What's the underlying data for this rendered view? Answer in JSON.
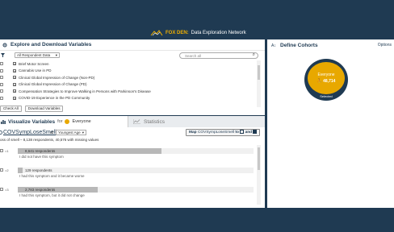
{
  "header": {
    "brand": "FOX DEN:",
    "subtitle": "Data Exploration Network"
  },
  "explore": {
    "title": "Explore and Download Variables",
    "dataset_select": "All Respondent Data",
    "search_placeholder": "Search all",
    "variables": [
      "Brief Motor Screen",
      "Cannabis Use in PD",
      "Clinical Global Impression of Change (Non-PD)",
      "Clinical Global Impression of Change (PD)",
      "Compensation Strategies to Improve Walking in Persons with Parkinson's Disease",
      "COVID-19 Experience in the PD Community"
    ],
    "check_all_label": "Check All",
    "download_label": "Download Variables"
  },
  "visualize": {
    "title": "Visualize Variables",
    "for_label": "for",
    "cohort_name": "Everyone",
    "variable_name": "COVSympLoseSmell",
    "at_label": "at",
    "age_select": "Youngest Age",
    "map_button_prefix": "Map",
    "map_button_variable": "COVSympLoseSmell",
    "map_button_to": "to",
    "map_button_and": "and",
    "summary": "oss of smell – 8,138 respondents, 40,576 with missing values",
    "responses": [
      {
        "code": "=1",
        "count_label": "8,641 respondents",
        "fraction": 0.61,
        "label": "I did not have this symptom"
      },
      {
        "code": "=2",
        "count_label": "129 respondents",
        "fraction": 0.02,
        "label": "I had this symptom and it became worse"
      },
      {
        "code": "=3",
        "count_label": "2,783 respondents",
        "fraction": 0.34,
        "label": "I had this symptom, but it did not change"
      }
    ]
  },
  "statistics": {
    "tab_label": "Statistics"
  },
  "cohorts": {
    "title": "Define Cohorts",
    "options_label": "Options",
    "cohort_name": "Everyone",
    "cohort_count": "48,714",
    "cohort_status": "Selected"
  },
  "colors": {
    "navy": "#1f3a52",
    "accent": "#e8a800"
  }
}
